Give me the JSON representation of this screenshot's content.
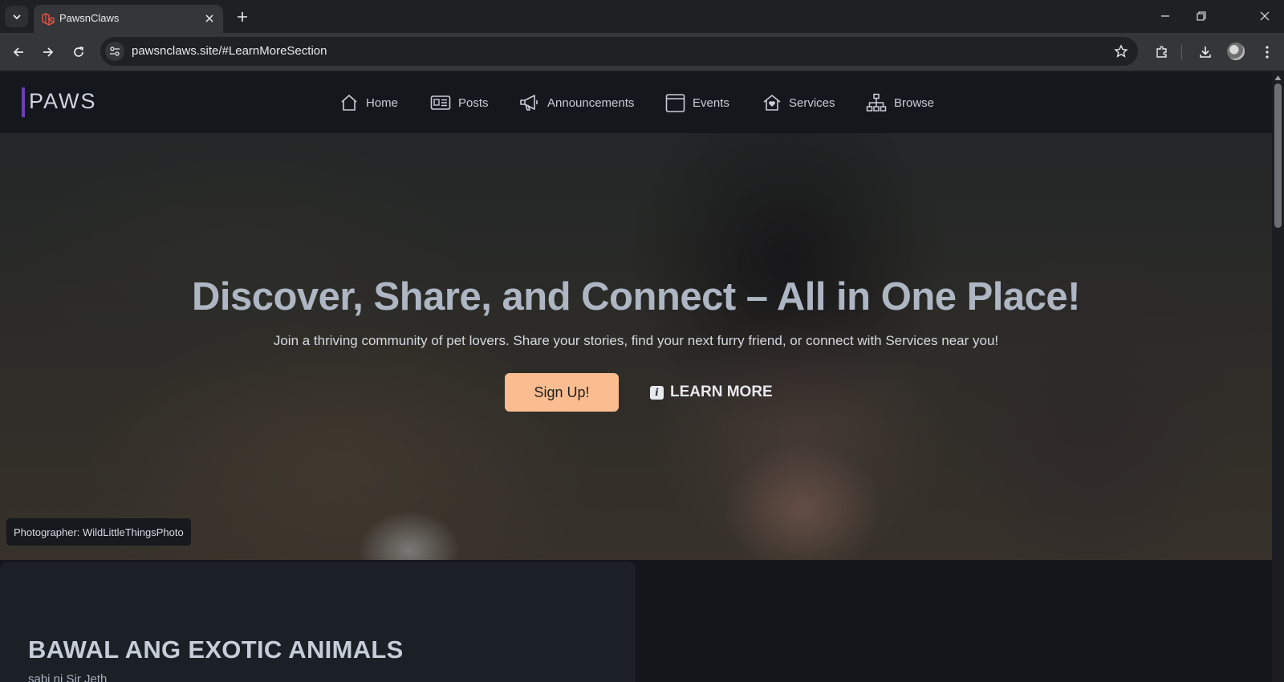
{
  "browser": {
    "tab_title": "PawsnClaws",
    "url": "pawsnclaws.site/#LearnMoreSection"
  },
  "site": {
    "logo": "PAWS",
    "nav": [
      {
        "label": "Home",
        "icon": "home-icon"
      },
      {
        "label": "Posts",
        "icon": "newspaper-icon"
      },
      {
        "label": "Announcements",
        "icon": "megaphone-icon"
      },
      {
        "label": "Events",
        "icon": "calendar-icon"
      },
      {
        "label": "Services",
        "icon": "home-heart-icon"
      },
      {
        "label": "Browse",
        "icon": "sitemap-icon"
      }
    ]
  },
  "hero": {
    "title": "Discover, Share, and Connect – All in One Place!",
    "subtitle": "Join a thriving community of pet lovers. Share your stories, find your next furry friend, or connect with Services near you!",
    "signup_label": "Sign Up!",
    "learn_more_label": "LEARN MORE",
    "info_glyph": "i",
    "photo_credit": "Photographer: WildLittleThingsPhoto"
  },
  "post": {
    "title": "BAWAL ANG EXOTIC ANIMALS",
    "author": "sabi ni Sir Jeth"
  },
  "colors": {
    "accent": "#fbbd8f",
    "logo_bar": "#6b3fb5",
    "background": "#14171c"
  }
}
